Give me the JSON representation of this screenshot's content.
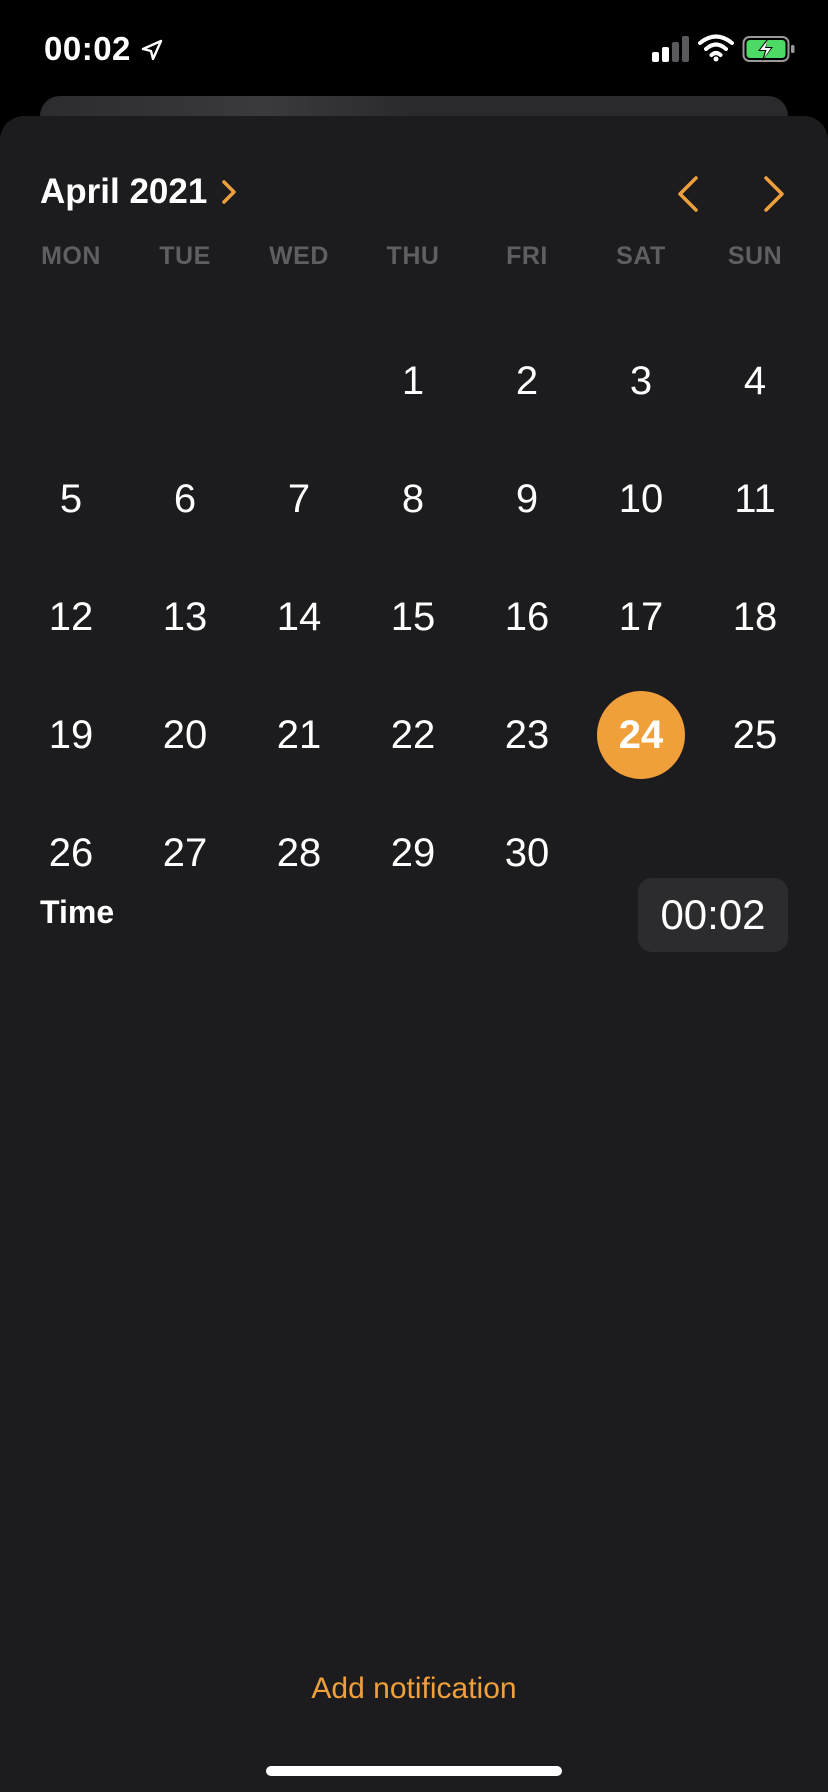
{
  "status_bar": {
    "time": "00:02"
  },
  "calendar": {
    "month_label": "April 2021",
    "weekdays": [
      "MON",
      "TUE",
      "WED",
      "THU",
      "FRI",
      "SAT",
      "SUN"
    ],
    "weeks": [
      [
        "",
        "",
        "",
        "1",
        "2",
        "3",
        "4"
      ],
      [
        "5",
        "6",
        "7",
        "8",
        "9",
        "10",
        "11"
      ],
      [
        "12",
        "13",
        "14",
        "15",
        "16",
        "17",
        "18"
      ],
      [
        "19",
        "20",
        "21",
        "22",
        "23",
        "24",
        "25"
      ],
      [
        "26",
        "27",
        "28",
        "29",
        "30",
        "",
        ""
      ]
    ],
    "selected_day": "24"
  },
  "time": {
    "label": "Time",
    "value": "00:02"
  },
  "footer": {
    "add_notification": "Add notification"
  },
  "colors": {
    "accent": "#f0a03b",
    "sheet_background": "#1c1c1e",
    "weekday_text": "#5e5e63",
    "time_pill": "#2c2c2e"
  }
}
